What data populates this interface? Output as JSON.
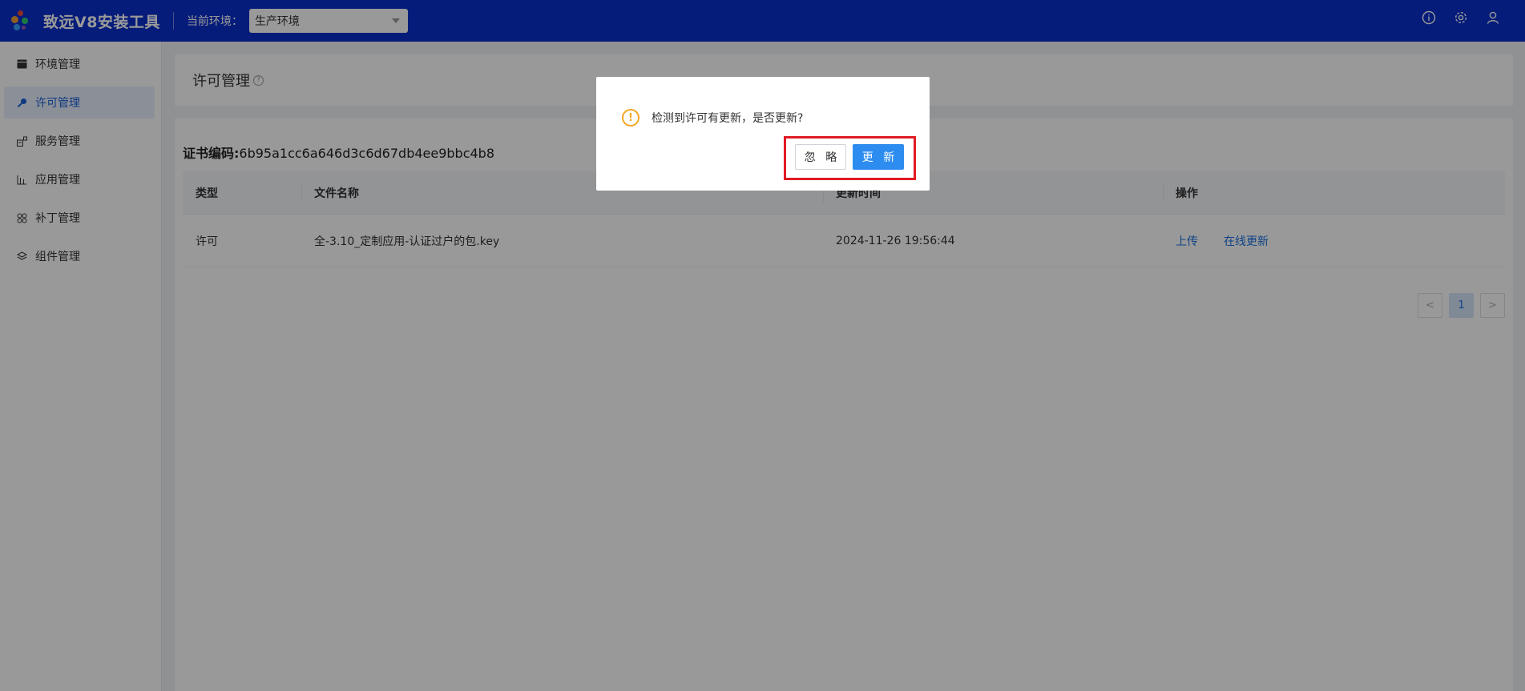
{
  "header": {
    "app_title": "致远V8安装工具",
    "env_label": "当前环境：",
    "env_selected": "生产环境",
    "icons": [
      "info-icon",
      "gear-icon",
      "user-icon"
    ]
  },
  "sidebar": {
    "items": [
      {
        "label": "环境管理",
        "icon": "env-icon",
        "active": false
      },
      {
        "label": "许可管理",
        "icon": "key-icon",
        "active": true
      },
      {
        "label": "服务管理",
        "icon": "service-icon",
        "active": false
      },
      {
        "label": "应用管理",
        "icon": "app-icon",
        "active": false
      },
      {
        "label": "补丁管理",
        "icon": "patch-icon",
        "active": false
      },
      {
        "label": "组件管理",
        "icon": "layers-icon",
        "active": false
      }
    ]
  },
  "page": {
    "title": "许可管理",
    "help": "?",
    "cert_label": "证书编码:",
    "cert_code": "6b95a1cc6a646d3c6d67db4ee9bbc4b8"
  },
  "table": {
    "columns": [
      "类型",
      "文件名称",
      "更新时间",
      "操作"
    ],
    "rows": [
      {
        "type": "许可",
        "file_name": "全-3.10_定制应用-认证过户的包.key",
        "updated_at": "2024-11-26 19:56:44",
        "actions": [
          "上传",
          "在线更新"
        ]
      }
    ]
  },
  "pagination": {
    "prev": "<",
    "current": "1",
    "next": ">"
  },
  "dialog": {
    "icon": "warning-icon",
    "message": "检测到许可有更新，是否更新?",
    "ignore_label": "忽 略",
    "update_label": "更 新"
  },
  "colors": {
    "header_bg": "#0a2fcc",
    "accent": "#2d8cf0",
    "link": "#1b6fe0",
    "warning": "#f5a623",
    "highlight": "#e01b24"
  }
}
